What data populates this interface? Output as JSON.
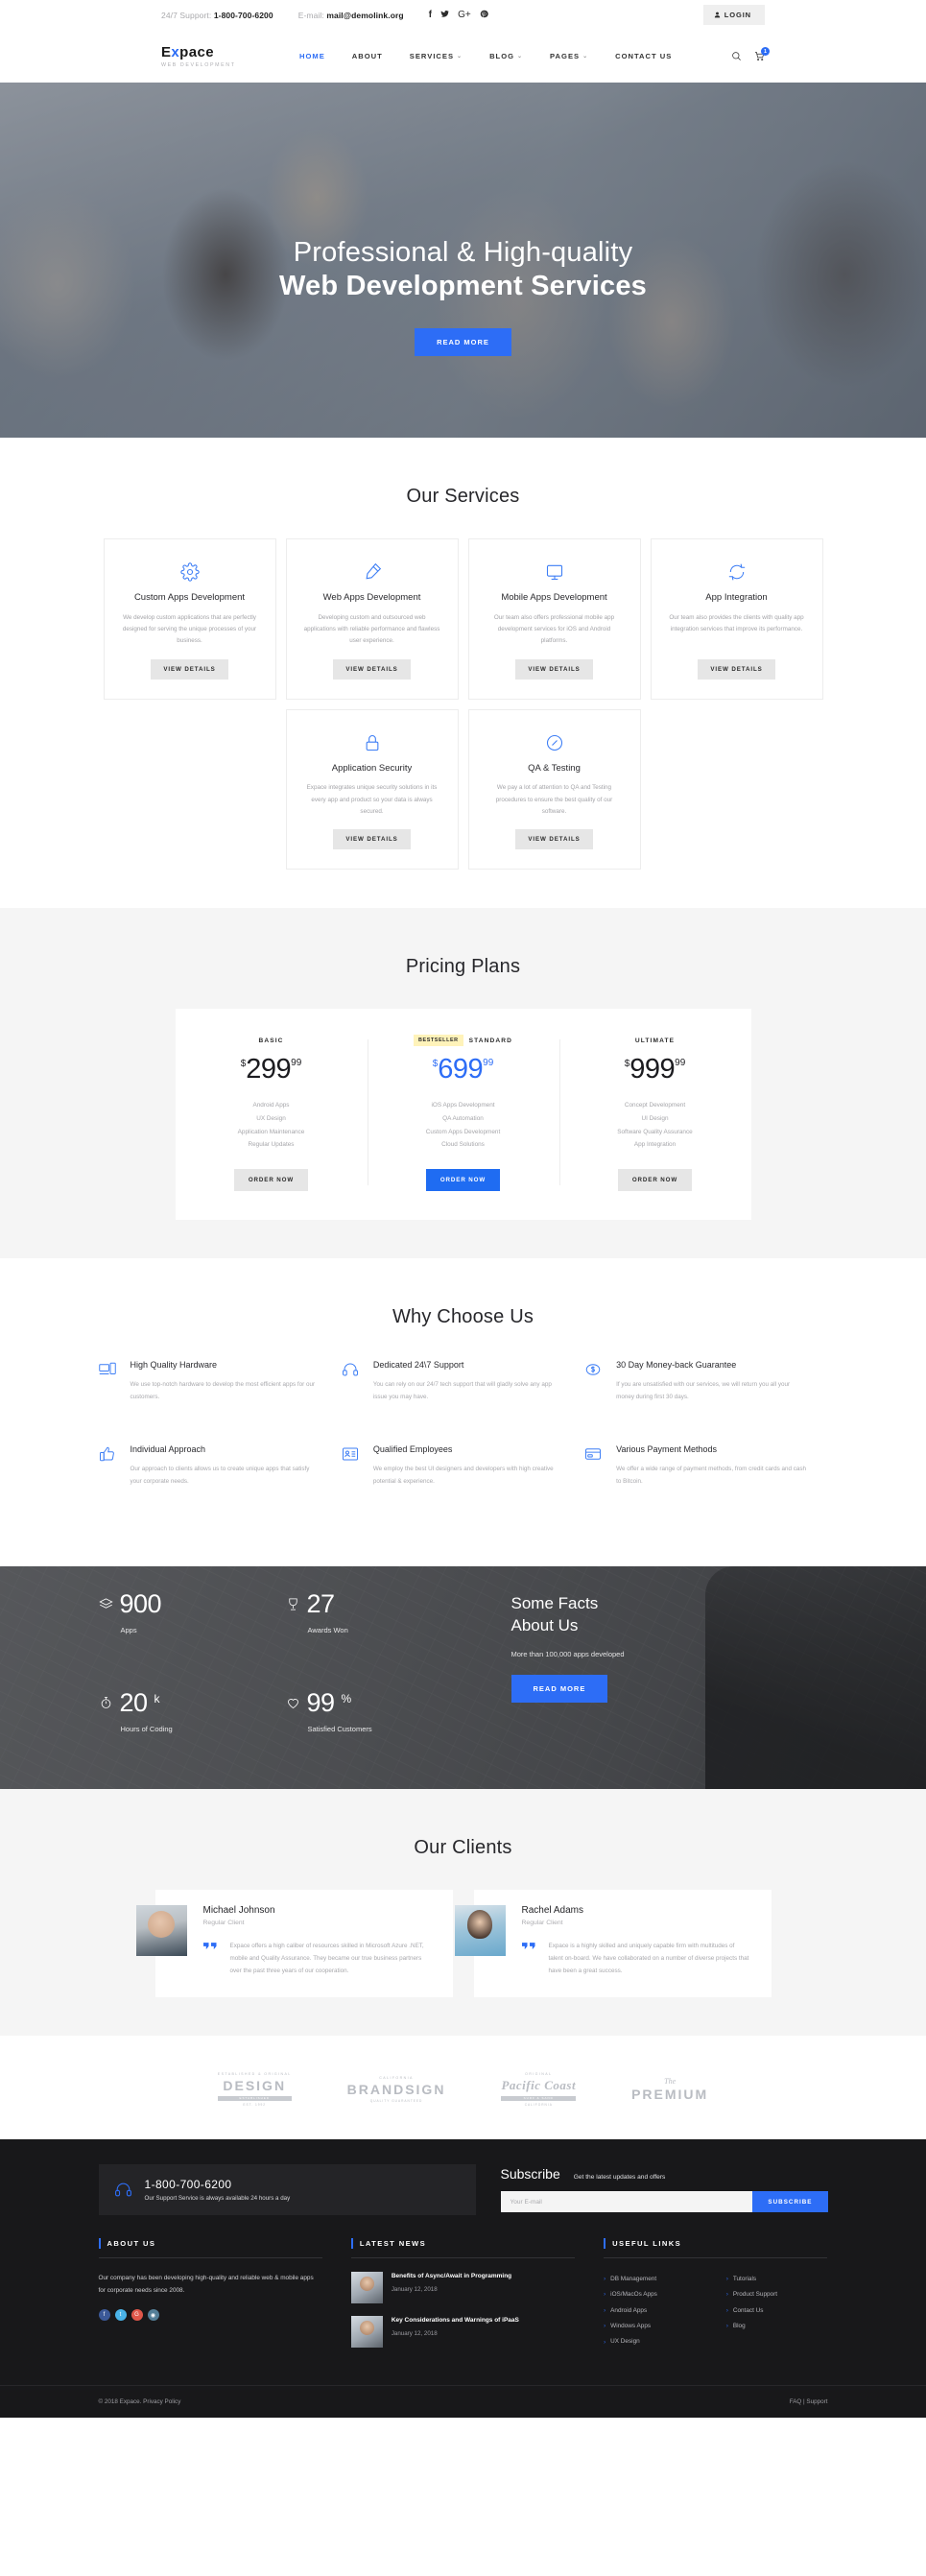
{
  "topbar": {
    "support_label": "24/7 Support:",
    "support_phone": "1-800-700-6200",
    "email_label": "E-mail:",
    "email": "mail@demolink.org",
    "social": [
      "f",
      "twitter",
      "G+",
      "P"
    ],
    "login_label": "LOGIN"
  },
  "nav": {
    "logo_main_1": "E",
    "logo_main_x": "x",
    "logo_main_2": "pace",
    "logo_sub": "WEB DEVELOPMENT",
    "items": [
      {
        "label": "HOME",
        "caret": false
      },
      {
        "label": "ABOUT",
        "caret": false
      },
      {
        "label": "SERVICES",
        "caret": true
      },
      {
        "label": "BLOG",
        "caret": true
      },
      {
        "label": "PAGES",
        "caret": true
      },
      {
        "label": "CONTACT US",
        "caret": false
      }
    ],
    "cart_count": "1"
  },
  "hero": {
    "line1": "Professional & High-quality",
    "line2": "Web Development Services",
    "cta": "READ MORE"
  },
  "services": {
    "title": "Our Services",
    "button_label": "VIEW DETAILS",
    "items": [
      {
        "icon": "gear-icon",
        "title": "Custom Apps Development",
        "desc": "We develop custom applications that are perfectly designed for serving the unique processes of your business."
      },
      {
        "icon": "pencil-icon",
        "title": "Web Apps Development",
        "desc": "Developing custom and outsourced web applications with reliable performance and flawless user experience."
      },
      {
        "icon": "monitor-icon",
        "title": "Mobile Apps Development",
        "desc": "Our team also offers professional mobile app development services for iOS and Android platforms."
      },
      {
        "icon": "sync-icon",
        "title": "App Integration",
        "desc": "Our team also provides the clients with quality app integration services that improve its performance."
      },
      {
        "icon": "lock-icon",
        "title": "Application Security",
        "desc": "Expace integrates unique security solutions in its every app and product so your data is always secured."
      },
      {
        "icon": "gauge-icon",
        "title": "QA & Testing",
        "desc": "We pay a lot of attention to QA and Testing procedures to ensure the best quality of our software."
      }
    ]
  },
  "pricing": {
    "title": "Pricing Plans",
    "plans": [
      {
        "badge": "",
        "name": "BASIC",
        "currency": "$",
        "integer": "299",
        "decimal": "99",
        "highlight": false,
        "features": [
          "Android Apps",
          "UX Design",
          "Application Maintenance",
          "Regular Updates"
        ],
        "button": "ORDER NOW"
      },
      {
        "badge": "BESTSELLER",
        "name": "STANDARD",
        "currency": "$",
        "integer": "699",
        "decimal": "99",
        "highlight": true,
        "features": [
          "iOS Apps Development",
          "QA Automation",
          "Custom Apps Development",
          "Cloud Solutions"
        ],
        "button": "ORDER NOW"
      },
      {
        "badge": "",
        "name": "ULTIMATE",
        "currency": "$",
        "integer": "999",
        "decimal": "99",
        "highlight": false,
        "features": [
          "Concept Development",
          "UI Design",
          "Software Quality Assurance",
          "App Integration"
        ],
        "button": "ORDER NOW"
      }
    ]
  },
  "why": {
    "title": "Why Choose Us",
    "items": [
      {
        "icon": "devices-icon",
        "title": "High Quality Hardware",
        "desc": "We use top-notch hardware to develop the most efficient apps for our customers."
      },
      {
        "icon": "headset-icon",
        "title": "Dedicated 24\\7 Support",
        "desc": "You can rely on our 24/7 tech support that will gladly solve any app issue you may have."
      },
      {
        "icon": "coin-icon",
        "title": "30 Day Money-back Guarantee",
        "desc": "If you are unsatisfied with our services, we will return you all your money during first 30 days."
      },
      {
        "icon": "thumbs-up-icon",
        "title": "Individual Approach",
        "desc": "Our approach to clients allows us to create unique apps that satisfy your corporate needs."
      },
      {
        "icon": "id-card-icon",
        "title": "Qualified Employees",
        "desc": "We employ the best UI designers and developers with high creative potential & experience."
      },
      {
        "icon": "credit-card-icon",
        "title": "Various Payment Methods",
        "desc": "We offer a wide range of payment methods, from credit cards and cash to Bitcoin."
      }
    ]
  },
  "facts": {
    "title_line1": "Some Facts",
    "title_line2": "About Us",
    "subtitle": "More than 100,000 apps developed",
    "cta": "READ MORE",
    "counters": [
      {
        "icon": "layers-icon",
        "number": "900",
        "suffix": "",
        "label": "Apps"
      },
      {
        "icon": "trophy-icon",
        "number": "27",
        "suffix": "",
        "label": "Awards Won"
      },
      {
        "icon": "stopwatch-icon",
        "number": "20",
        "suffix": "k",
        "label": "Hours of Coding"
      },
      {
        "icon": "heart-icon",
        "number": "99",
        "suffix": "%",
        "label": "Satisfied Customers"
      }
    ]
  },
  "clients": {
    "title": "Our Clients",
    "items": [
      {
        "photo": "male-avatar",
        "name": "Michael Johnson",
        "role": "Regular Client",
        "text": "Expace offers a high caliber of resources skilled in Microsoft Azure .NET, mobile and Quality Assurance. They became our true business partners over the past three years of our cooperation."
      },
      {
        "photo": "female-avatar",
        "name": "Rachel Adams",
        "role": "Regular Client",
        "text": "Expace is a highly skilled and uniquely capable firm with multitudes of talent on-board. We have collaborated on a number of diverse projects that have been a great success."
      }
    ]
  },
  "brands": [
    {
      "top": "ESTABLISHED & ORIGINAL",
      "main": "DESIGN",
      "bar": "ESTABLISHED",
      "bot": "EST. 1992"
    },
    {
      "top": "CALIFORNIA",
      "main": "BRANDSIGN",
      "bar": "",
      "bot": "QUALITY GUARANTEED"
    },
    {
      "top": "ORIGINAL",
      "main": "Pacific Coast",
      "bar": "SURF & SAND",
      "bot": "CALIFORNIA"
    },
    {
      "top": "",
      "main": "PREMIUM",
      "bar": "",
      "bot": "",
      "the": "The"
    }
  ],
  "footer": {
    "support": {
      "phone": "1-800-700-6200",
      "note": "Our Support Service is always available 24 hours a day"
    },
    "subscribe": {
      "title": "Subscribe",
      "subtitle": "Get the latest updates and offers",
      "placeholder": "Your E-mail",
      "value": "",
      "button": "SUBSCRIBE"
    },
    "about": {
      "title": "ABOUT US",
      "text": "Our company has been developing high-quality and reliable web & mobile apps for corporate needs since 2008.",
      "social": [
        "f",
        "t",
        "G+",
        "in"
      ]
    },
    "news": {
      "title": "LATEST NEWS",
      "items": [
        {
          "title": "Benefits of Async/Await in Programming",
          "date": "January 12, 2018"
        },
        {
          "title": "Key Considerations and Warnings of iPaaS",
          "date": "January 12, 2018"
        }
      ]
    },
    "links": {
      "title": "USEFUL LINKS",
      "col1": [
        "DB Management",
        "iOS/MacOs Apps",
        "Android Apps",
        "Windows Apps",
        "UX Design"
      ],
      "col2": [
        "Tutorials",
        "Product Support",
        "Contact Us",
        "Blog"
      ]
    },
    "copyright": "© 2018 Expace. Privacy Policy",
    "copyright_links": "FAQ | Support"
  },
  "colors": {
    "accent": "#2d6df6",
    "badge": "#fff3ba",
    "dark": "#18181a"
  }
}
